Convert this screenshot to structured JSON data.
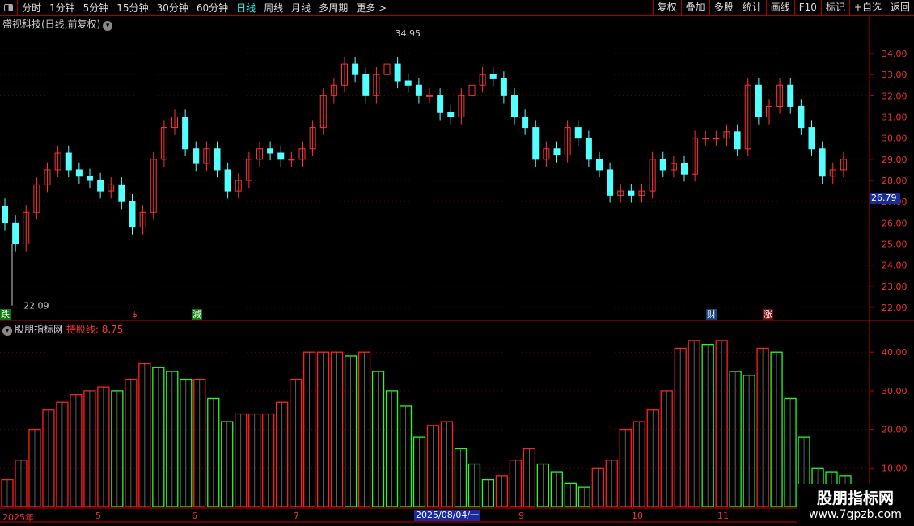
{
  "toolbar": {
    "periods": [
      "分时",
      "1分钟",
      "5分钟",
      "15分钟",
      "30分钟",
      "60分钟",
      "日线",
      "周线",
      "月线",
      "多周期",
      "更多 >"
    ],
    "active": "日线",
    "buttons": [
      "复权",
      "叠加",
      "多股",
      "统计",
      "画线",
      "F10",
      "标记",
      "+自选",
      "返回"
    ]
  },
  "title": "盛视科技(日线,前复权)",
  "price_chart": {
    "y_ticks": [
      "34.00",
      "33.00",
      "32.00",
      "31.00",
      "30.00",
      "29.00",
      "28.00",
      "27.00",
      "26.00",
      "25.00",
      "24.00",
      "23.00",
      "22.00"
    ],
    "max_label": "34.95",
    "min_label": "22.09",
    "current_price": "26.79",
    "closes": [
      26,
      25,
      26.5,
      27.8,
      28.5,
      29.3,
      28.5,
      28.2,
      28,
      27.5,
      27.8,
      27,
      25.8,
      26.5,
      29,
      30.5,
      31,
      29.5,
      28.8,
      29.5,
      28.5,
      27.5,
      28,
      29,
      29.5,
      29.3,
      29,
      29,
      29.5,
      30.5,
      32,
      32.5,
      33.5,
      33,
      32,
      33,
      33.5,
      32.7,
      32.5,
      32,
      32,
      31.2,
      31,
      32,
      32.5,
      33,
      32.8,
      32,
      31,
      30.5,
      29,
      29.5,
      29.2,
      30.5,
      30,
      29,
      28.5,
      27.3,
      27.5,
      27.3,
      27.5,
      29,
      28.5,
      28.8,
      28.3,
      30,
      30,
      30,
      30.3,
      29.5,
      32.5,
      31,
      31.5,
      32.5,
      31.5,
      30.5,
      29.5,
      28.2,
      28.5,
      29
    ],
    "colors": {
      "up": "#ff3232",
      "down": "#54ffff"
    },
    "markers": [
      {
        "text": "跌",
        "bg": "#0a7a0a"
      },
      {
        "text": "$",
        "bg": "transparent"
      },
      {
        "text": "減",
        "bg": "#0a7a0a"
      },
      {
        "text": "财",
        "bg": "#14427a"
      },
      {
        "text": "涨",
        "bg": "#7a0a0a"
      }
    ]
  },
  "indicator": {
    "name": "股朋指标网",
    "line_label": "持股线: 8.75",
    "y_ticks": [
      "40.00",
      "30.00",
      "20.00",
      "10.00"
    ],
    "values": [
      7,
      12,
      20,
      25,
      27,
      29,
      30,
      31,
      30,
      33,
      37,
      36,
      35,
      33,
      33,
      28,
      22,
      24,
      24,
      24,
      27,
      33,
      40,
      40,
      40,
      39,
      40,
      35,
      30,
      26,
      18,
      21,
      22,
      15,
      11,
      7,
      8,
      12,
      15,
      11,
      9,
      6,
      5,
      10,
      12,
      20,
      22,
      25,
      30,
      41,
      43,
      42,
      43,
      35,
      34,
      41,
      40,
      28,
      18,
      10,
      9,
      8
    ],
    "colors": {
      "rise": "#ff2020",
      "fall": "#20ff20"
    }
  },
  "date_axis": {
    "labels": [
      "2025年",
      "5",
      "6",
      "7",
      "9",
      "10",
      "11"
    ],
    "cursor": "2025/08/04/一"
  },
  "watermark": {
    "name": "股朋指标网",
    "url": "www.7gpzb.com"
  }
}
